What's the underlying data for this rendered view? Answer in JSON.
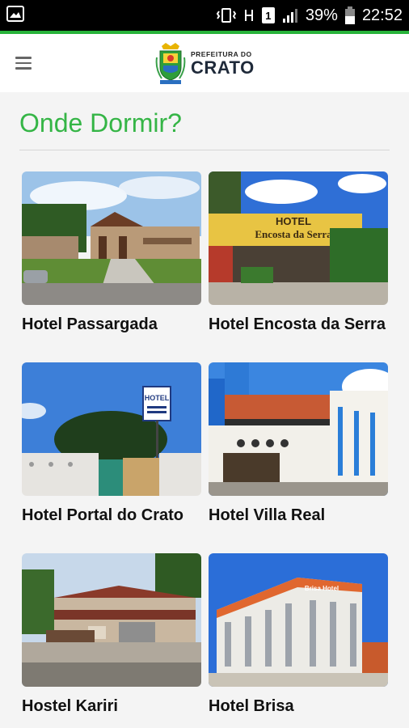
{
  "status_bar": {
    "battery_percent": "39%",
    "time": "22:52",
    "sim_label": "1"
  },
  "header": {
    "logo_small": "PREFEITURA DO",
    "logo_big": "CRATO"
  },
  "page": {
    "title": "Onde Dormir?"
  },
  "hotels": [
    {
      "name": "Hotel Passargada"
    },
    {
      "name": "Hotel Encosta da Serra"
    },
    {
      "name": "Hotel Portal do Crato"
    },
    {
      "name": "Hotel Villa Real"
    },
    {
      "name": "Hostel Kariri"
    },
    {
      "name": "Hotel Brisa"
    }
  ],
  "photo_signs": {
    "encosta_sign_line1": "HOTEL",
    "encosta_sign_line2": "Encosta da Serra",
    "portal_sign": "HOTEL",
    "brisa_sign": "Brisa Hotel"
  },
  "colors": {
    "accent_green": "#35b546",
    "status_bar": "#000000",
    "divider": "#d6d6d6"
  }
}
